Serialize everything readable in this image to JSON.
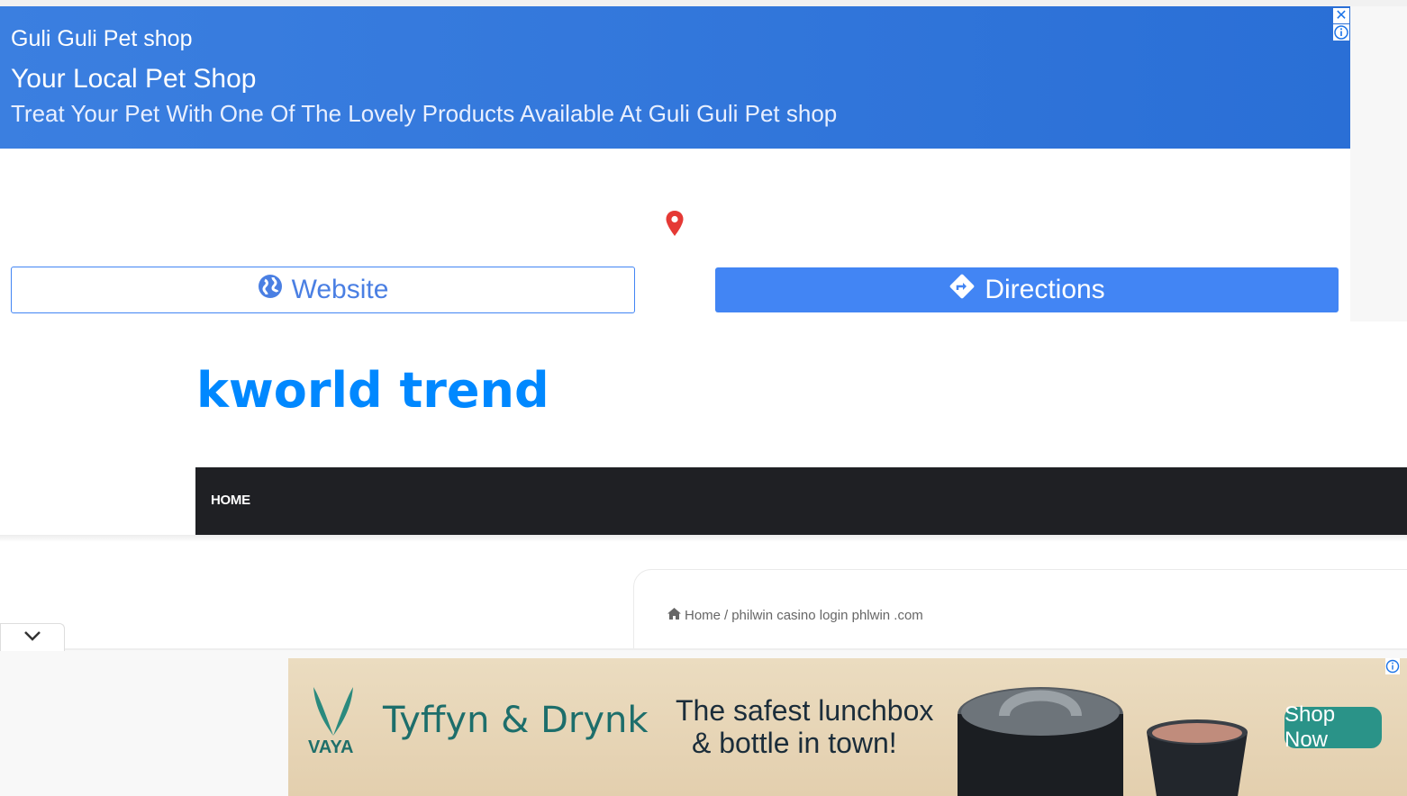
{
  "top_ad": {
    "shop_name": "Guli Guli Pet shop",
    "headline": "Your Local Pet Shop",
    "description": "Treat Your Pet With One Of The Lovely Products Available At Guli Guli Pet shop",
    "close_glyph": "✕",
    "website_label": "Website",
    "directions_label": "Directions",
    "icons": {
      "pin": "map-pin-icon",
      "globe": "globe-icon",
      "directions": "directions-icon",
      "info": "info-icon",
      "close": "close-icon"
    },
    "colors": {
      "banner": "#2f76dd",
      "button_primary": "#4285f4",
      "pin": "#e53935"
    }
  },
  "site": {
    "logo": "kworld trend",
    "nav": {
      "home": "HOME"
    },
    "colors": {
      "logo": "#0088ff",
      "nav_bg": "#1f2024"
    }
  },
  "breadcrumb": {
    "home": "Home",
    "separator": "/",
    "current": "philwin casino login phlwin .com"
  },
  "bottom_ad": {
    "logo_text": "VAYA",
    "brand": "Tyffyn & Drynk",
    "tagline_line1": "The safest lunchbox",
    "tagline_line2": "& bottle in town!",
    "cta": "Shop Now",
    "colors": {
      "bg": "#e8d7b8",
      "cta": "#2a9388",
      "brand": "#1d6e6b"
    }
  },
  "anchor": {
    "toggle_icon": "chevron-down-icon"
  }
}
